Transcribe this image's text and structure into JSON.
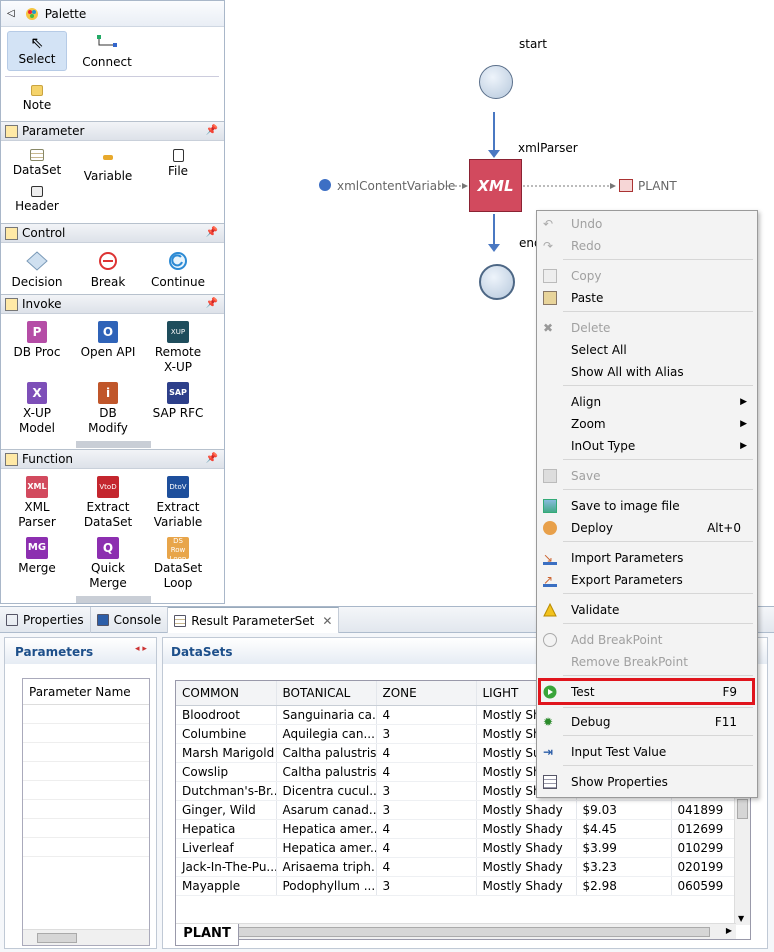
{
  "palette": {
    "title": "Palette",
    "tools": {
      "select": "Select",
      "connect": "Connect",
      "note": "Note"
    },
    "drawers": {
      "parameter": {
        "label": "Parameter",
        "items": [
          "DataSet",
          "Variable",
          "File",
          "Header"
        ]
      },
      "control": {
        "label": "Control",
        "items": [
          "Decision",
          "Break",
          "Continue"
        ]
      },
      "invoke": {
        "label": "Invoke",
        "items": [
          {
            "l1": "DB Proc",
            "l2": ""
          },
          {
            "l1": "Open API",
            "l2": ""
          },
          {
            "l1": "Remote",
            "l2": "X-UP"
          },
          {
            "l1": "X-UP",
            "l2": "Model"
          },
          {
            "l1": "DB",
            "l2": "Modify"
          },
          {
            "l1": "SAP RFC",
            "l2": ""
          }
        ]
      },
      "function": {
        "label": "Function",
        "items": [
          {
            "l1": "XML",
            "l2": "Parser"
          },
          {
            "l1": "Extract",
            "l2": "DataSet"
          },
          {
            "l1": "Extract",
            "l2": "Variable"
          },
          {
            "l1": "Merge",
            "l2": ""
          },
          {
            "l1": "Quick",
            "l2": "Merge"
          },
          {
            "l1": "DataSet",
            "l2": "Loop"
          }
        ]
      }
    }
  },
  "canvas": {
    "start_label": "start",
    "parser_label": "xmlParser",
    "xml_node": "XML",
    "input_var": "xmlContentVariable",
    "output": "PLANT",
    "end_label": "end"
  },
  "bottom": {
    "tabs": [
      "Properties",
      "Console",
      "Result ParameterSet"
    ],
    "parameters_title": "Parameters",
    "param_col": "Parameter Name",
    "datasets_title": "DataSets",
    "dataset_tab": "PLANT",
    "columns": [
      "COMMON",
      "BOTANICAL",
      "ZONE",
      "LIGHT",
      "",
      ""
    ],
    "rows": [
      [
        "Bloodroot",
        "Sanguinaria ca...",
        "4",
        "Mostly Shady",
        "",
        ""
      ],
      [
        "Columbine",
        "Aquilegia can...",
        "3",
        "Mostly Shady",
        "",
        ""
      ],
      [
        "Marsh Marigold",
        "Caltha palustris",
        "4",
        "Mostly Sunny",
        "",
        ""
      ],
      [
        "Cowslip",
        "Caltha palustris",
        "4",
        "Mostly Shady",
        "",
        ""
      ],
      [
        "Dutchman's-Br...",
        "Dicentra cucul...",
        "3",
        "Mostly Shady",
        "",
        ""
      ],
      [
        "Ginger, Wild",
        "Asarum canad...",
        "3",
        "Mostly Shady",
        "$9.03",
        "041899"
      ],
      [
        "Hepatica",
        "Hepatica amer...",
        "4",
        "Mostly Shady",
        "$4.45",
        "012699"
      ],
      [
        "Liverleaf",
        "Hepatica amer...",
        "4",
        "Mostly Shady",
        "$3.99",
        "010299"
      ],
      [
        "Jack-In-The-Pu...",
        "Arisaema triph...",
        "4",
        "Mostly Shady",
        "$3.23",
        "020199"
      ],
      [
        "Mayapple",
        "Podophyllum ...",
        "3",
        "Mostly Shady",
        "$2.98",
        "060599"
      ]
    ]
  },
  "menu": {
    "undo": "Undo",
    "redo": "Redo",
    "copy": "Copy",
    "paste": "Paste",
    "delete": "Delete",
    "select_all": "Select All",
    "show_alias": "Show All with Alias",
    "align": "Align",
    "zoom": "Zoom",
    "inout": "InOut Type",
    "save": "Save",
    "save_image": "Save to image file",
    "deploy": "Deploy",
    "deploy_sc": "Alt+0",
    "import": "Import Parameters",
    "export": "Export Parameters",
    "validate": "Validate",
    "add_bp": "Add BreakPoint",
    "remove_bp": "Remove BreakPoint",
    "test": "Test",
    "test_sc": "F9",
    "debug": "Debug",
    "debug_sc": "F11",
    "input_test": "Input Test Value",
    "show_props": "Show Properties"
  },
  "colors": {
    "highlight": "#e0141c",
    "xml_node": "#d24a5e",
    "selection": "#d3e3f5"
  }
}
